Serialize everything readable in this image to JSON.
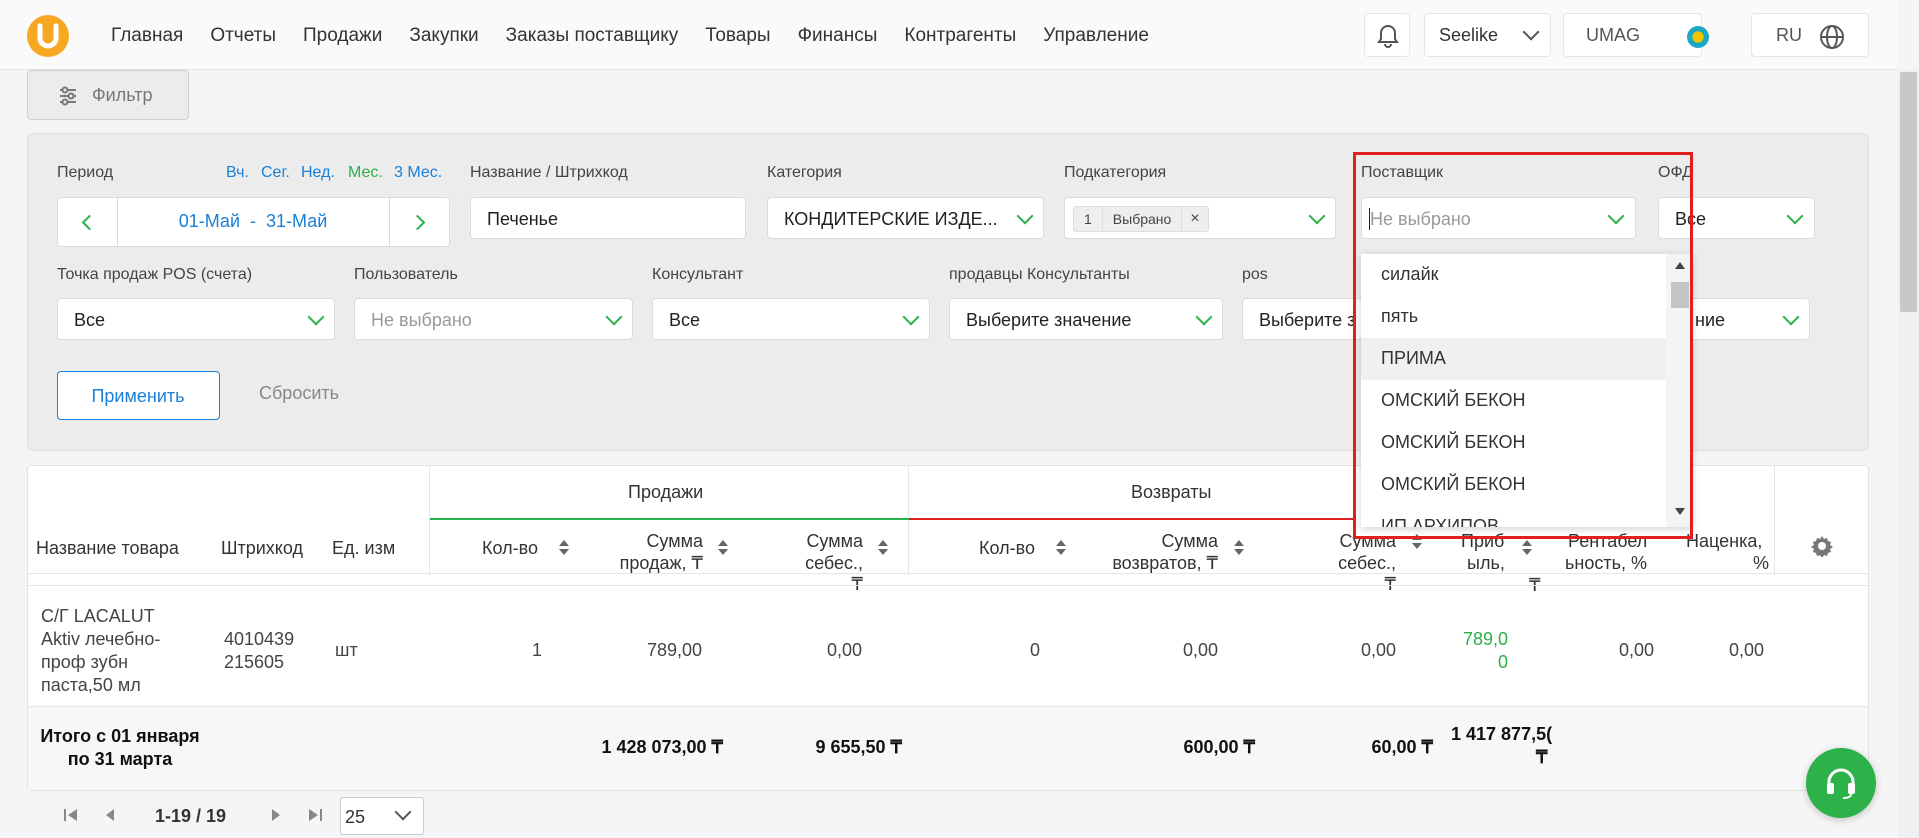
{
  "nav": {
    "menu": [
      "Главная",
      "Отчеты",
      "Продажи",
      "Закупки",
      "Заказы поставщику",
      "Товары",
      "Финансы",
      "Контрагенты",
      "Управление"
    ],
    "store": "Seelike",
    "company": "UMAG",
    "language": "RU"
  },
  "filter_button": "Фильтр",
  "filters": {
    "period_label": "Период",
    "period_quick": [
      "Вч.",
      "Сег.",
      "Нед.",
      "Мес.",
      "3 Мес."
    ],
    "period_value": "01-Май  -  31-Май",
    "name_label": "Название / Штрихкод",
    "name_value": "Печенье",
    "category_label": "Категория",
    "category_value": "КОНДИТЕРСКИЕ ИЗДЕ...",
    "subcategory_label": "Подкатегория",
    "subcategory_count": "1",
    "subcategory_chip": "Выбрано",
    "supplier_label": "Поставщик",
    "supplier_placeholder": "Не выбрано",
    "ofd_label": "ОФД",
    "ofd_value": "Все",
    "pos_label": "Точка продаж POS (счета)",
    "pos_value": "Все",
    "user_label": "Пользователь",
    "user_value": "Не выбрано",
    "consultant_label": "Консультант",
    "consultant_value": "Все",
    "sellers_label": "продавцы Консультанты",
    "sellers_value": "Выберите значение",
    "pos2_label": "pos",
    "pos2_value": "Выберите з",
    "extra_value": "ние",
    "apply": "Применить",
    "reset": "Сбросить"
  },
  "supplier_dropdown": {
    "items": [
      "силайк",
      "пять",
      "ПРИМА",
      "ОМСКИЙ БЕКОН",
      "ОМСКИЙ БЕКОН",
      "ОМСКИЙ БЕКОН",
      "ИП АРХИПОВ"
    ],
    "hovered_index": 2
  },
  "table": {
    "group_sales": "Продажи",
    "group_returns": "Возвраты",
    "headers": {
      "name": "Название товара",
      "barcode": "Штрихкод",
      "unit": "Ед. изм",
      "qty": "Кол-во",
      "sales_sum_1": "Сумма",
      "sales_sum_2": "продаж, ₸",
      "cost_1": "Сумма",
      "cost_2": "себес., ₸",
      "ret_qty": "Кол-во",
      "ret_sum_1": "Сумма",
      "ret_sum_2": "возвратов, ₸",
      "ret_cost_1": "Сумма",
      "ret_cost_2": "себес., ₸",
      "profit_1": "Приб",
      "profit_2": "ыль,",
      "profit_3": "₸",
      "rent_1": "Рентабел",
      "rent_2": "ьность, %",
      "markup_1": "Наценка,",
      "markup_2": "%"
    },
    "row": {
      "name_lines": [
        "С/Г LACALUT",
        "Aktiv лечебно-",
        "проф зубн",
        "паста,50 мл"
      ],
      "barcode_lines": [
        "4010439",
        "215605"
      ],
      "unit": "шт",
      "qty": "1",
      "sales_sum": "789,00",
      "cost": "0,00",
      "ret_qty": "0",
      "ret_sum": "0,00",
      "ret_cost": "0,00",
      "profit_lines": [
        "789,0",
        "0"
      ],
      "rent": "0,00",
      "markup": "0,00"
    },
    "total": {
      "label_1": "Итого с 01 января",
      "label_2": "по 31 марта",
      "sales_sum": "1 428 073,00 ₸",
      "cost": "9 655,50 ₸",
      "ret_sum": "600,00 ₸",
      "ret_cost": "60,00 ₸",
      "profit_1": "1 417 877,5(",
      "profit_2": "₸"
    }
  },
  "pagination": {
    "range": "1-19 / 19",
    "page_size": "25"
  },
  "colors": {
    "accent_green": "#2bb04a",
    "accent_blue": "#1a7fd6",
    "returns_red": "#e02020",
    "logo_orange": "#f7a823"
  }
}
